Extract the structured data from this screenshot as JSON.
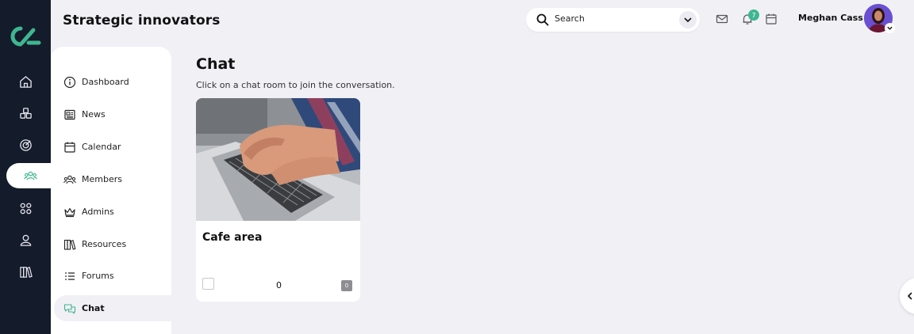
{
  "app": {
    "org_title": "Strategic innovators"
  },
  "colors": {
    "rail_bg": "#141b2b",
    "accent": "#3fb68f",
    "page_bg": "#f1f0f5",
    "avatar_bg": "#6a4fd3"
  },
  "rail": {
    "logo": "brand-logo",
    "items": [
      {
        "icon": "home-icon"
      },
      {
        "icon": "groups-icon"
      },
      {
        "icon": "target-icon"
      },
      {
        "icon": "members-icon",
        "active": true
      },
      {
        "icon": "apps-icon"
      },
      {
        "icon": "profile-icon"
      },
      {
        "icon": "library-icon"
      }
    ]
  },
  "header": {
    "search": {
      "placeholder": "Search"
    },
    "notifications_count": "7",
    "user_name": "Meghan Cass"
  },
  "subnav": {
    "items": [
      {
        "label": "Dashboard",
        "icon": "info-icon"
      },
      {
        "label": "News",
        "icon": "news-icon"
      },
      {
        "label": "Calendar",
        "icon": "calendar-icon"
      },
      {
        "label": "Members",
        "icon": "members-icon"
      },
      {
        "label": "Admins",
        "icon": "crown-icon"
      },
      {
        "label": "Resources",
        "icon": "books-icon"
      },
      {
        "label": "Forums",
        "icon": "list-icon"
      },
      {
        "label": "Chat",
        "icon": "chat-icon",
        "active": true
      }
    ]
  },
  "main": {
    "title": "Chat",
    "subtitle": "Click on a chat room to join the conversation.",
    "rooms": [
      {
        "name": "Cafe area",
        "count": "0",
        "badge": "0"
      }
    ]
  }
}
